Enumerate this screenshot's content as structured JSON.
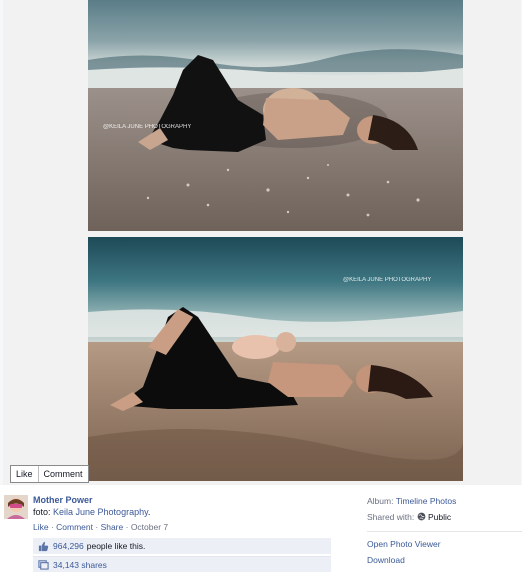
{
  "photos": [
    {
      "watermark": "@KEILA JUNE PHOTOGRAPHY"
    },
    {
      "watermark": "@KEILA JUNE PHOTOGRAPHY"
    }
  ],
  "photo_actions": {
    "like_label": "Like",
    "comment_label": "Comment"
  },
  "post": {
    "author": "Mother Power",
    "caption_prefix": "foto: ",
    "caption_link": "Keila June Photography",
    "caption_suffix": ".",
    "like_label": "Like",
    "comment_label": "Comment",
    "share_label": "Share",
    "sep": " · ",
    "date": "October 7",
    "likes_count": "964,296",
    "likes_suffix": "people like this.",
    "shares_text": "34,143 shares"
  },
  "sidebar": {
    "album_label": "Album:",
    "album_value": "Timeline Photos",
    "shared_label": "Shared with:",
    "shared_value": "Public",
    "open_viewer": "Open Photo Viewer",
    "download": "Download"
  },
  "colors": {
    "link": "#3b5998",
    "muted": "#6a7180"
  }
}
